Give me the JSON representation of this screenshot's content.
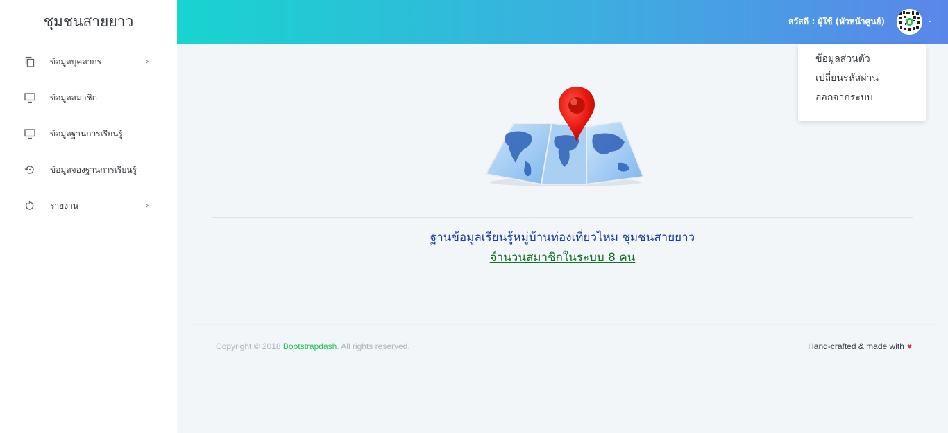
{
  "brand": {
    "title": "ชุมชนสายยาว"
  },
  "sidebar": {
    "items": [
      {
        "label": "ข้อมูลบุคลากร",
        "icon": "copy-icon",
        "has_arrow": true
      },
      {
        "label": "ข้อมูลสมาชิก",
        "icon": "monitor-icon",
        "has_arrow": false
      },
      {
        "label": "ข้อมูลฐานการเรียนรู้",
        "icon": "monitor-icon",
        "has_arrow": false
      },
      {
        "label": "ข้อมูลจองฐานการเรียนรู้",
        "icon": "history-icon",
        "has_arrow": false
      },
      {
        "label": "รายงาน",
        "icon": "refresh-icon",
        "has_arrow": true
      }
    ],
    "arrow": "›"
  },
  "header": {
    "greeting": "สวัสดี : ผู้ใช้ (หัวหน้าศูนย์)",
    "caret": "⌄",
    "colors": {
      "gradient_start": "#18d4cf",
      "gradient_end": "#5a86ea"
    }
  },
  "user_menu": {
    "items": [
      {
        "label": "ข้อมูลส่วนตัว"
      },
      {
        "label": "เปลี่ยนรหัสผ่าน"
      },
      {
        "label": "ออกจากระบบ"
      }
    ]
  },
  "main": {
    "headline": "ฐานข้อมูลเรียนรู้หมู่บ้านท่องเที่ยวไหม ชุมชนสายยาว",
    "member_count": "จำนวนสมาชิกในระบบ 8 คน"
  },
  "footer": {
    "copyright_prefix": "Copyright © 2018 ",
    "copyright_link": "Bootstrapdash",
    "copyright_suffix": ". All rights reserved.",
    "credits": "Hand-crafted & made with",
    "heart": "♥"
  }
}
